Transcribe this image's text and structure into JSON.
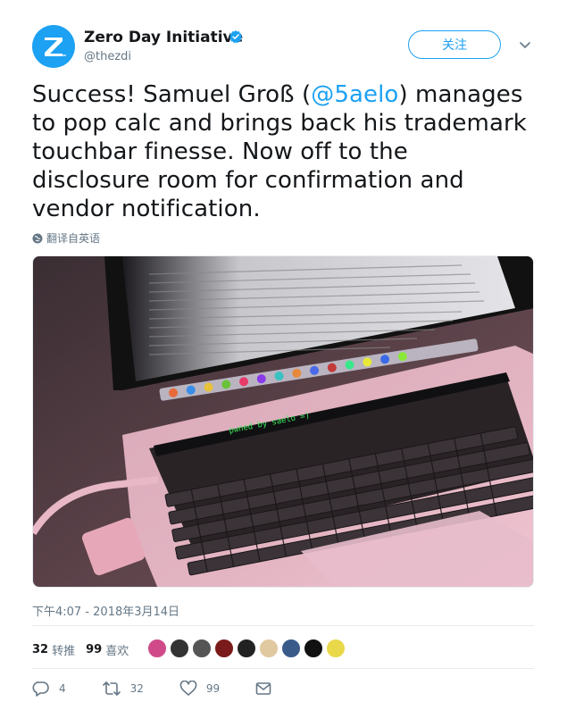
{
  "account": {
    "display_name": "Zero Day Initiative",
    "handle": "@thezdi",
    "verified": true,
    "avatar_letter": "Z"
  },
  "follow_label": "关注",
  "tweet": {
    "text_before": "Success! Samuel Groß (",
    "mention": "@5aelo",
    "text_after": ") manages to pop calc and brings back his trademark touchbar finesse. Now off to the disclosure room for confirmation and vendor notification.",
    "translate_label": "翻译自英语"
  },
  "photo": {
    "touchbar_text": "pwned by saelo =)"
  },
  "timestamp": "下午4:07 - 2018年3月14日",
  "stats": {
    "retweets_count": "32",
    "retweets_label": "转推",
    "likes_count": "99",
    "likes_label": "喜欢"
  },
  "actions": {
    "reply_count": "4",
    "retweet_count": "32",
    "like_count": "99"
  },
  "colors": {
    "brand_blue": "#1da1f2",
    "muted_text": "#657786",
    "divider": "#e6ecf0"
  },
  "icons": [
    "verified-badge-icon",
    "chevron-down-icon",
    "globe-icon",
    "reply-icon",
    "retweet-icon",
    "like-icon",
    "message-icon"
  ]
}
